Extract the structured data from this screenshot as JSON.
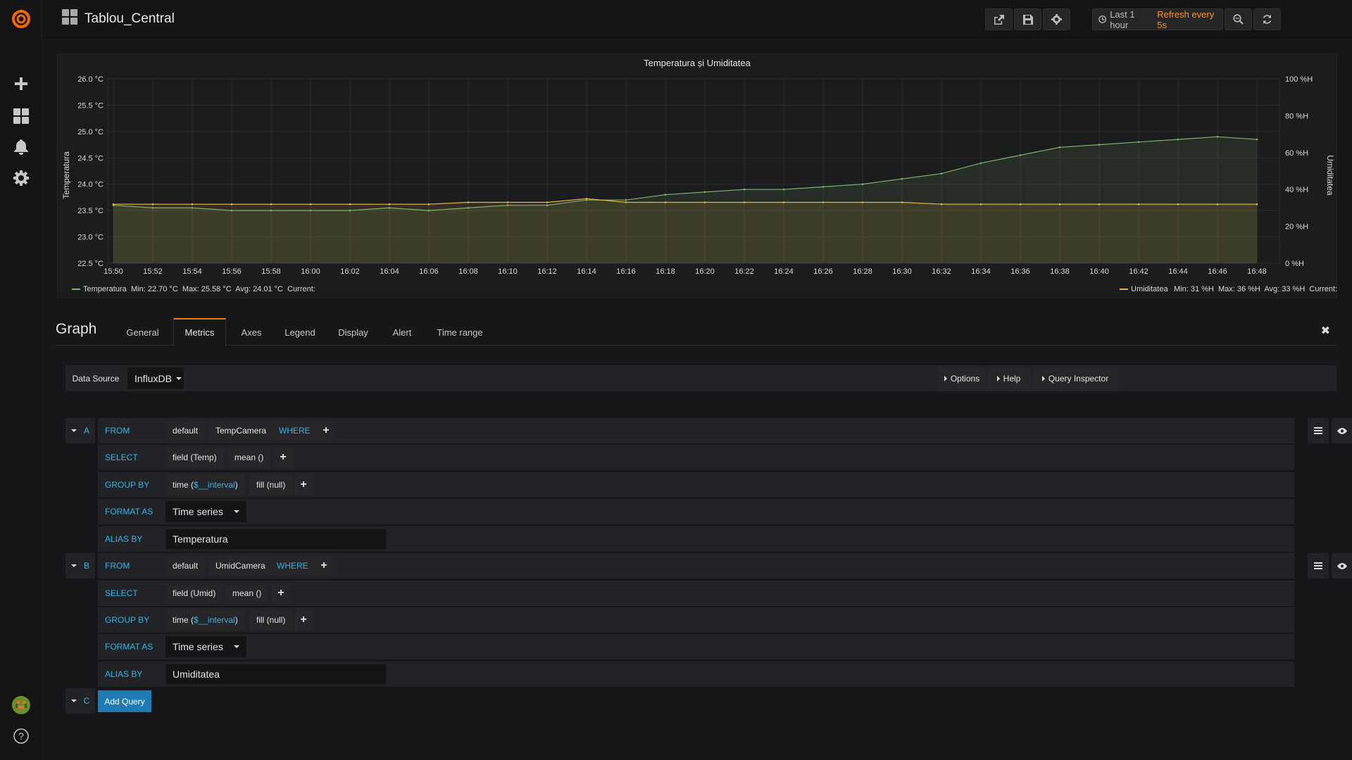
{
  "navbar": {
    "dashboard_title": "Tablou_Central",
    "time_range": "Last 1 hour",
    "refresh": "Refresh every 5s"
  },
  "chart_data": {
    "type": "line",
    "title": "Temperatura și Umiditatea",
    "ylabel_left": "Temperatura",
    "ylabel_right": "Umiditatea",
    "ylim_left": [
      22.5,
      26.0
    ],
    "ylim_right": [
      0,
      100
    ],
    "y_ticks_left": [
      "22.5 °C",
      "23.0 °C",
      "23.5 °C",
      "24.0 °C",
      "24.5 °C",
      "25.0 °C",
      "25.5 °C",
      "26.0 °C"
    ],
    "y_ticks_right": [
      "0 %H",
      "20 %H",
      "40 %H",
      "60 %H",
      "80 %H",
      "100 %H"
    ],
    "x": [
      "15:50",
      "15:52",
      "15:54",
      "15:56",
      "15:58",
      "16:00",
      "16:02",
      "16:04",
      "16:06",
      "16:08",
      "16:10",
      "16:12",
      "16:14",
      "16:16",
      "16:18",
      "16:20",
      "16:22",
      "16:24",
      "16:26",
      "16:28",
      "16:30",
      "16:32",
      "16:34",
      "16:36",
      "16:38",
      "16:40",
      "16:42",
      "16:44",
      "16:46",
      "16:48"
    ],
    "grid": true,
    "series": [
      {
        "name": "Temperatura",
        "axis": "left",
        "color": "#7eb26d",
        "values": [
          23.6,
          23.55,
          23.55,
          23.5,
          23.5,
          23.5,
          23.5,
          23.55,
          23.5,
          23.55,
          23.6,
          23.6,
          23.7,
          23.7,
          23.8,
          23.85,
          23.9,
          23.9,
          23.95,
          24.0,
          24.1,
          24.2,
          24.4,
          24.55,
          24.7,
          24.75,
          24.8,
          24.85,
          24.9,
          24.85
        ],
        "legend": "Min: 22.70 °C  Max: 25.58 °C  Avg: 24.01 °C  Current:"
      },
      {
        "name": "Umiditatea",
        "axis": "right",
        "color": "#eab839",
        "values": [
          32,
          32,
          32,
          32,
          32,
          32,
          32,
          32,
          32,
          33,
          33,
          33,
          35,
          33,
          33,
          33,
          33,
          33,
          33,
          33,
          33,
          32,
          32,
          32,
          32,
          32,
          32,
          32,
          32,
          32
        ],
        "legend": "Min: 31 %H  Max: 36 %H  Avg: 33 %H  Current:"
      }
    ]
  },
  "editor": {
    "title": "Graph",
    "tabs": [
      "General",
      "Metrics",
      "Axes",
      "Legend",
      "Display",
      "Alert",
      "Time range"
    ],
    "active_tab": "Metrics",
    "datasource_label": "Data Source",
    "datasource_value": "InfluxDB",
    "options_label": "Options",
    "help_label": "Help",
    "inspector_label": "Query Inspector"
  },
  "queries": [
    {
      "letter": "A",
      "from_kw": "FROM",
      "policy": "default",
      "measurement": "TempCamera",
      "where_kw": "WHERE",
      "select_kw": "SELECT",
      "field": "field (Temp)",
      "func": "mean ()",
      "group_kw": "GROUP BY",
      "time_prefix": "time (",
      "time_var": "$__interval",
      "time_suffix": ")",
      "fill": "fill (null)",
      "format_kw": "FORMAT AS",
      "format": "Time series",
      "alias_kw": "ALIAS BY",
      "alias": "Temperatura"
    },
    {
      "letter": "B",
      "from_kw": "FROM",
      "policy": "default",
      "measurement": "UmidCamera",
      "where_kw": "WHERE",
      "select_kw": "SELECT",
      "field": "field (Umid)",
      "func": "mean ()",
      "group_kw": "GROUP BY",
      "time_prefix": "time (",
      "time_var": "$__interval",
      "time_suffix": ")",
      "fill": "fill (null)",
      "format_kw": "FORMAT AS",
      "format": "Time series",
      "alias_kw": "ALIAS BY",
      "alias": "Umiditatea"
    }
  ],
  "add_query": {
    "letter": "C",
    "label": "Add Query"
  }
}
